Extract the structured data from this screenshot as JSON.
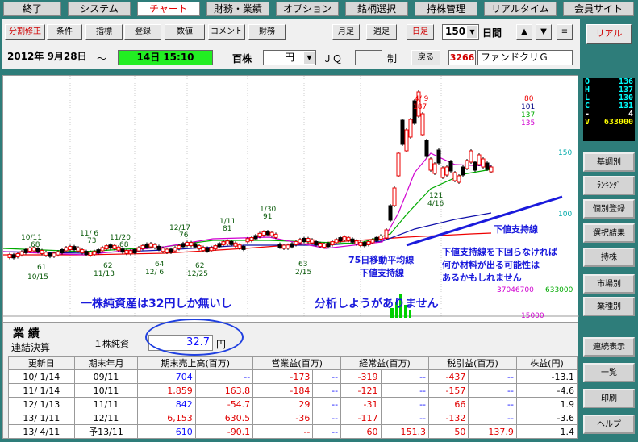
{
  "menu": [
    "終了",
    "システム",
    "チャート",
    "財務・業績",
    "オプション",
    "銘柄選択",
    "持株管理",
    "リアルタイム",
    "会員サイト"
  ],
  "tools": [
    "分割修正",
    "条件",
    "指標",
    "登録",
    "数値",
    "コメント",
    "財務"
  ],
  "periods": [
    "月足",
    "週足",
    "日足"
  ],
  "count": "150",
  "days_label": "日間",
  "up": "▲",
  "down": "▼",
  "menu_icon": "≡",
  "real": "リアル",
  "date_from": "2012年 9月28日",
  "tilde": "〜",
  "date_to": "14日 15:10",
  "unit_label": "百株",
  "currency": "円",
  "market": "ＪＱ",
  "sys": "制",
  "back": "戻る",
  "code": "3266",
  "name": "ファンドクリＧ",
  "ohlc": [
    {
      "k": "O",
      "v": "136"
    },
    {
      "k": "H",
      "v": "137"
    },
    {
      "k": "L",
      "v": "130"
    },
    {
      "k": "C",
      "v": "131"
    },
    {
      "k": "-",
      "v": "4"
    },
    {
      "k": "V",
      "v": "633000"
    }
  ],
  "side": [
    "基調別",
    "ﾗﾝｷﾝｸﾞ",
    "個別登録",
    "選択結果",
    "持株",
    "市場別",
    "業種別",
    "連続表示",
    "一覧",
    "印刷",
    "ヘルプ"
  ],
  "chart_labels": {
    "hi": "4/ 9",
    "hi_v": "187",
    "ma1": "80",
    "ma2": "101",
    "ma3": "137",
    "ma4": "135",
    "p150": "150",
    "p100": "100",
    "a1": "10/11",
    "a1v": "68",
    "a2": "11/ 6",
    "a2v": "73",
    "a3": "11/20",
    "a3v": "68",
    "a4": "12/17",
    "a4v": "76",
    "a5": "1/11",
    "a5v": "81",
    "a6": "1/30",
    "a6v": "91",
    "b1v": "61",
    "b1": "10/15",
    "b2v": "62",
    "b2": "11/13",
    "b3v": "64",
    "b3": "12/ 6",
    "b4v": "62",
    "b4": "12/25",
    "b5v": "63",
    "b5": "2/15",
    "c1": "121",
    "c2": "4/16",
    "vol1": "37046700",
    "vol2": "633000",
    "vol3": "15000"
  },
  "annotations": {
    "support1": "下値支持線",
    "ma75": "75日移動平均線",
    "support2": "下値支持線",
    "note1": "下値支持線を下回らなければ",
    "note2": "何か材料が出る可能性は",
    "note3": "あるかもしれません",
    "big1": "一株純資産は32円しか無いし",
    "big2": "分析しようがありません"
  },
  "fin": {
    "title": "業 績",
    "sub": "連結決算",
    "bps_label": "１株純資",
    "bps_val": "32.7",
    "bps_unit": "円",
    "headers": [
      "更新日",
      "期末年月",
      "期末売上高(百万)",
      "営業益(百万)",
      "経常益(百万)",
      "税引益(百万)",
      "株益(円)"
    ],
    "rows": [
      [
        "10/ 1/14",
        "09/11",
        "704",
        "--",
        "-173",
        "--",
        "-319",
        "--",
        "-437",
        "--",
        "-13.1"
      ],
      [
        "11/ 1/14",
        "10/11",
        "1,859",
        "163.8",
        "-184",
        "--",
        "-121",
        "--",
        "-157",
        "--",
        "-4.6"
      ],
      [
        "12/ 1/13",
        "11/11",
        "842",
        "-54.7",
        "29",
        "--",
        "-31",
        "--",
        "66",
        "--",
        "1.9"
      ],
      [
        "13/ 1/11",
        "12/11",
        "6,153",
        "630.5",
        "-36",
        "--",
        "-117",
        "--",
        "-132",
        "--",
        "-3.6"
      ],
      [
        "13/ 4/11",
        "予13/11",
        "610",
        "-90.1",
        "--",
        "--",
        "60",
        "151.3",
        "50",
        "137.9",
        "1.4"
      ]
    ]
  }
}
